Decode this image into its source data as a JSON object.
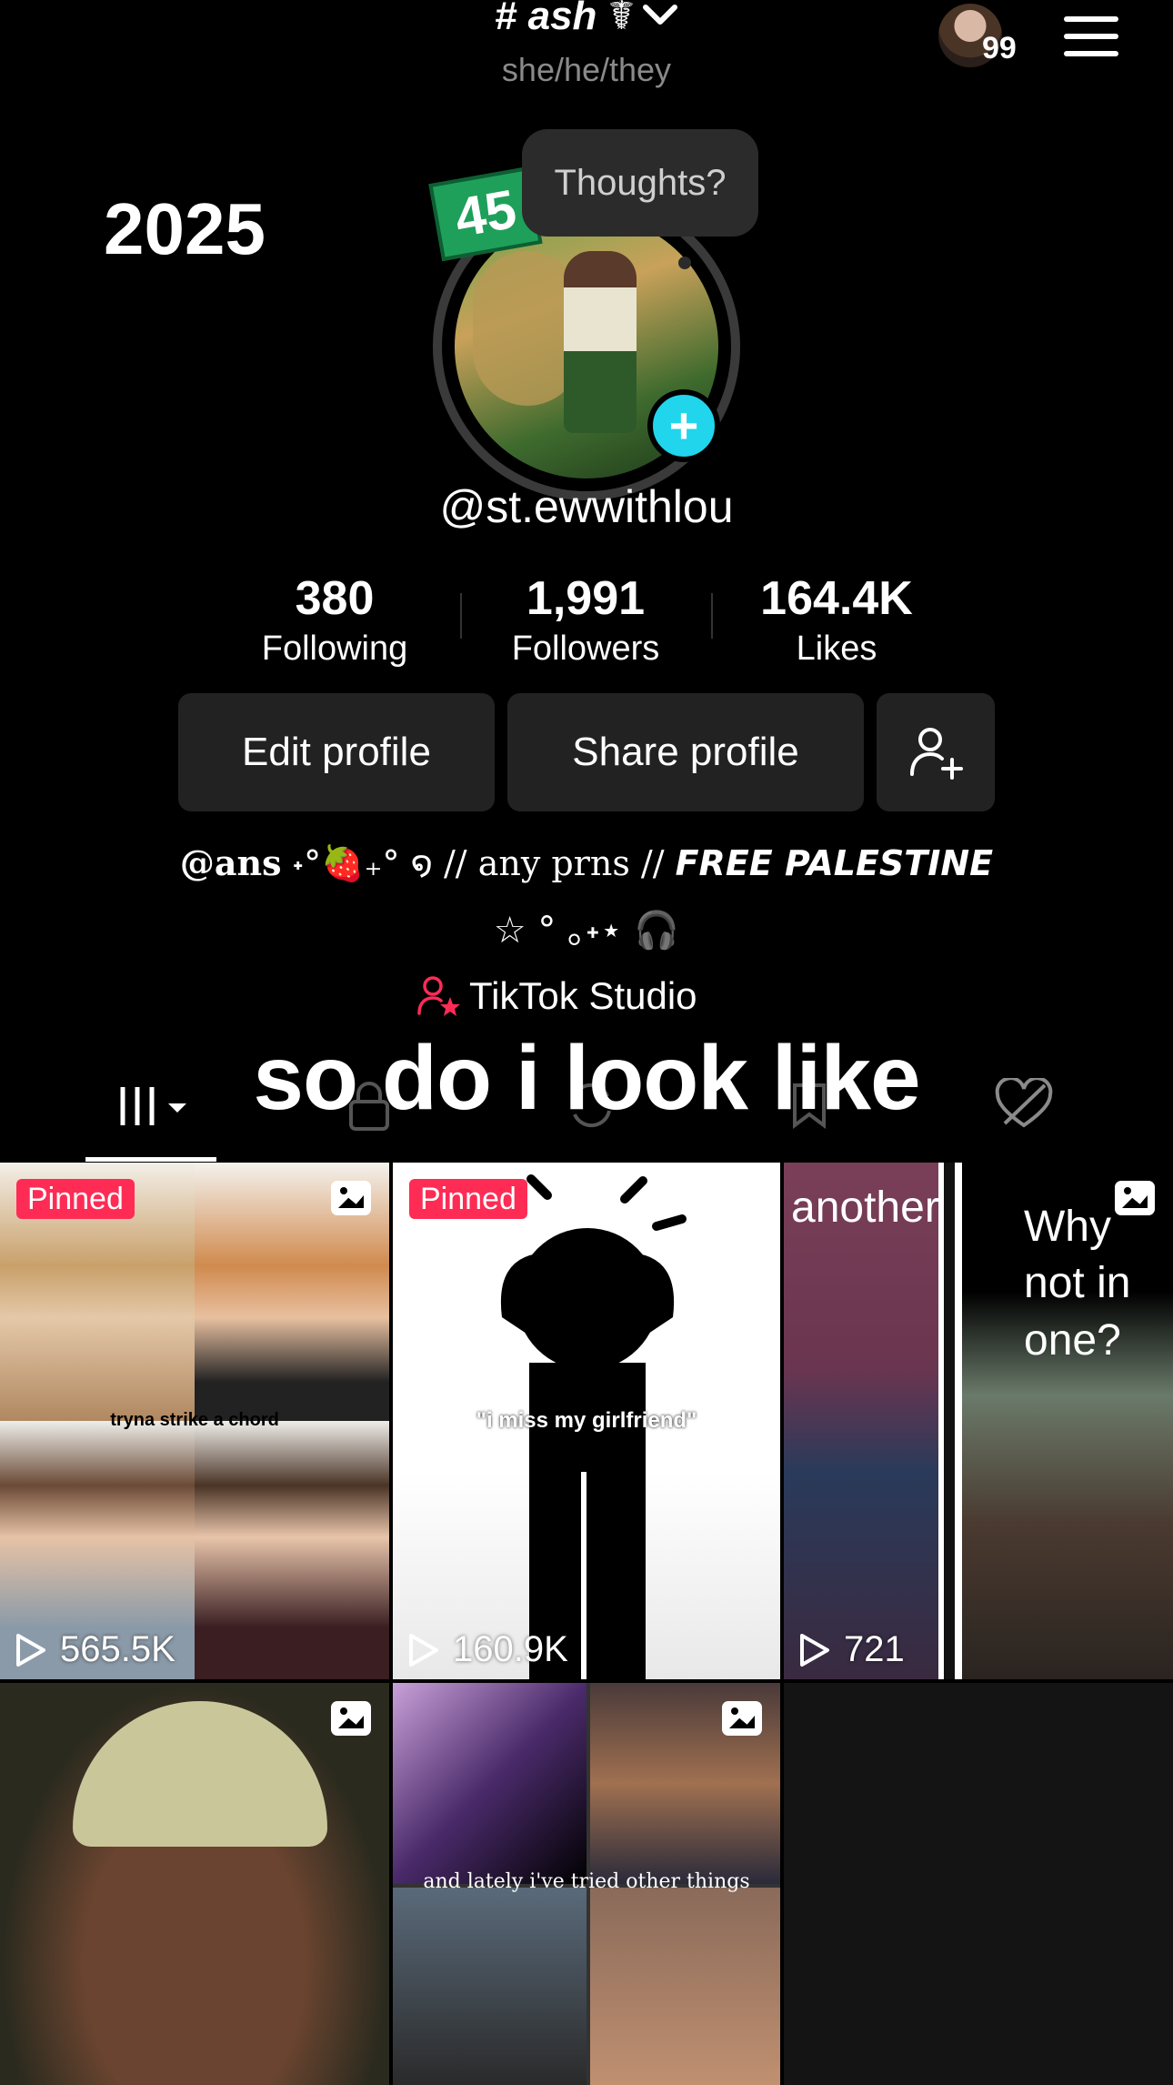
{
  "header": {
    "display_name": "# ash ☤",
    "pronouns": "she/he/they",
    "notification_count": "99"
  },
  "profile": {
    "year_label": "2025",
    "streak": "45",
    "thoughts_placeholder": "Thoughts?",
    "username": "@st.ewwithlou"
  },
  "stats": [
    {
      "value": "380",
      "label": "Following"
    },
    {
      "value": "1,991",
      "label": "Followers"
    },
    {
      "value": "164.4K",
      "label": "Likes"
    }
  ],
  "buttons": {
    "edit": "Edit profile",
    "share": "Share profile"
  },
  "bio": {
    "line1_handle": "@ans",
    "line1_deco": " ˖°🍓₊° ໑ // any prns // ",
    "line1_emphasis": "FREE PALESTINE",
    "line2": "☆ ° ｡˖⋆ 🎧"
  },
  "studio_label": "TikTok Studio",
  "overlay_caption": "so do i look like",
  "videos": [
    {
      "pinned": "Pinned",
      "views": "565.5K",
      "caption": "tryna strike a chord"
    },
    {
      "pinned": "Pinned",
      "views": "160.9K",
      "caption": "\"i miss my girlfriend\""
    },
    {
      "views": "721",
      "caption_left": "another",
      "caption_right": "Why not in one?"
    },
    {},
    {
      "caption": "and lately i've tried other things"
    },
    {}
  ],
  "colors": {
    "accent_cyan": "#20d5ec",
    "pinned_red": "#fe2c55",
    "button_bg": "#222222"
  }
}
